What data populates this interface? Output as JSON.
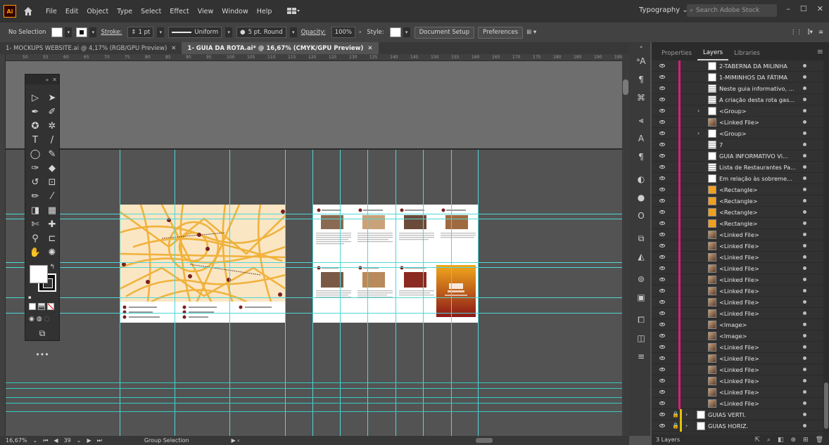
{
  "app": {
    "logo": "Ai",
    "menu": [
      "File",
      "Edit",
      "Object",
      "Type",
      "Select",
      "Effect",
      "View",
      "Window",
      "Help"
    ],
    "workspace": "Typography",
    "stock_search_placeholder": "Search Adobe Stock"
  },
  "control_bar": {
    "selection": "No Selection",
    "stroke_label": "Stroke:",
    "stroke_value": "1 pt",
    "profile": "Uniform",
    "brush": "5 pt. Round",
    "opacity_label": "Opacity:",
    "opacity_value": "100%",
    "style_label": "Style:",
    "document_setup": "Document Setup",
    "preferences": "Preferences"
  },
  "tabs": [
    {
      "label": "1- MOCKUPS WEBSITE.ai @ 4,17% (RGB/GPU Preview)",
      "active": false
    },
    {
      "label": "1- GUIA DA ROTA.ai* @ 16,67% (CMYK/GPU Preview)",
      "active": true
    }
  ],
  "status_bar": {
    "zoom": "16,67%",
    "artboard": "39",
    "tool": "Group Selection"
  },
  "ruler_ticks": [
    "50",
    "55",
    "60",
    "65",
    "70",
    "75",
    "80",
    "85",
    "90",
    "95",
    "100",
    "105",
    "110",
    "115",
    "120",
    "125",
    "130",
    "135",
    "140",
    "145",
    "150",
    "155",
    "160",
    "165",
    "170",
    "175",
    "180",
    "185",
    "190",
    "195"
  ],
  "layers_panel": {
    "tabs": [
      "Properties",
      "Layers",
      "Libraries"
    ],
    "active_tab": "Layers",
    "rows": [
      {
        "name": "2-TABERNA DA MILINHA",
        "thumb": "doc"
      },
      {
        "name": "1-MIMINHOS DA FÁTIMA",
        "thumb": "doc"
      },
      {
        "name": "Neste guia informativo, ...",
        "thumb": "text"
      },
      {
        "name": "A criação desta rota gas...",
        "thumb": "text"
      },
      {
        "name": "<Group>",
        "thumb": "white",
        "expand": true
      },
      {
        "name": "<Linked File>",
        "thumb": "photo"
      },
      {
        "name": "<Group>",
        "thumb": "white",
        "expand": true
      },
      {
        "name": "7",
        "thumb": "text"
      },
      {
        "name": "GUIA INFORMATIVO Vi...",
        "thumb": "doc"
      },
      {
        "name": "Lista de Restaurantes Pa...",
        "thumb": "text"
      },
      {
        "name": "Em relação às sobreme...",
        "thumb": "doc"
      },
      {
        "name": "<Rectangle>",
        "thumb": "orange"
      },
      {
        "name": "<Rectangle>",
        "thumb": "orange"
      },
      {
        "name": "<Rectangle>",
        "thumb": "orange"
      },
      {
        "name": "<Rectangle>",
        "thumb": "orange"
      },
      {
        "name": "<Linked File>",
        "thumb": "photo"
      },
      {
        "name": "<Linked File>",
        "thumb": "photo"
      },
      {
        "name": "<Linked File>",
        "thumb": "photo"
      },
      {
        "name": "<Linked File>",
        "thumb": "photo"
      },
      {
        "name": "<Linked File>",
        "thumb": "photo"
      },
      {
        "name": "<Linked File>",
        "thumb": "photo"
      },
      {
        "name": "<Linked File>",
        "thumb": "photo"
      },
      {
        "name": "<Linked File>",
        "thumb": "photo"
      },
      {
        "name": "<Image>",
        "thumb": "photo"
      },
      {
        "name": "<Image>",
        "thumb": "photo"
      },
      {
        "name": "<Linked File>",
        "thumb": "photo"
      },
      {
        "name": "<Linked File>",
        "thumb": "photo"
      },
      {
        "name": "<Linked File>",
        "thumb": "photo"
      },
      {
        "name": "<Linked File>",
        "thumb": "photo"
      },
      {
        "name": "<Linked File>",
        "thumb": "photo"
      },
      {
        "name": "<Linked File>",
        "thumb": "photo"
      }
    ],
    "top_layers": [
      "GUIAS VERTI.",
      "GUIAS HORIZ."
    ],
    "layer_count": "3 Layers"
  },
  "colors": {
    "layer_magenta": "#e0197d",
    "guide": "#4fd6d6",
    "map_bg": "#fbe6c4",
    "map_road": "#f0b23c",
    "cover_gradient_top": "#f2a81c",
    "cover_gradient_bottom": "#8b1818"
  }
}
